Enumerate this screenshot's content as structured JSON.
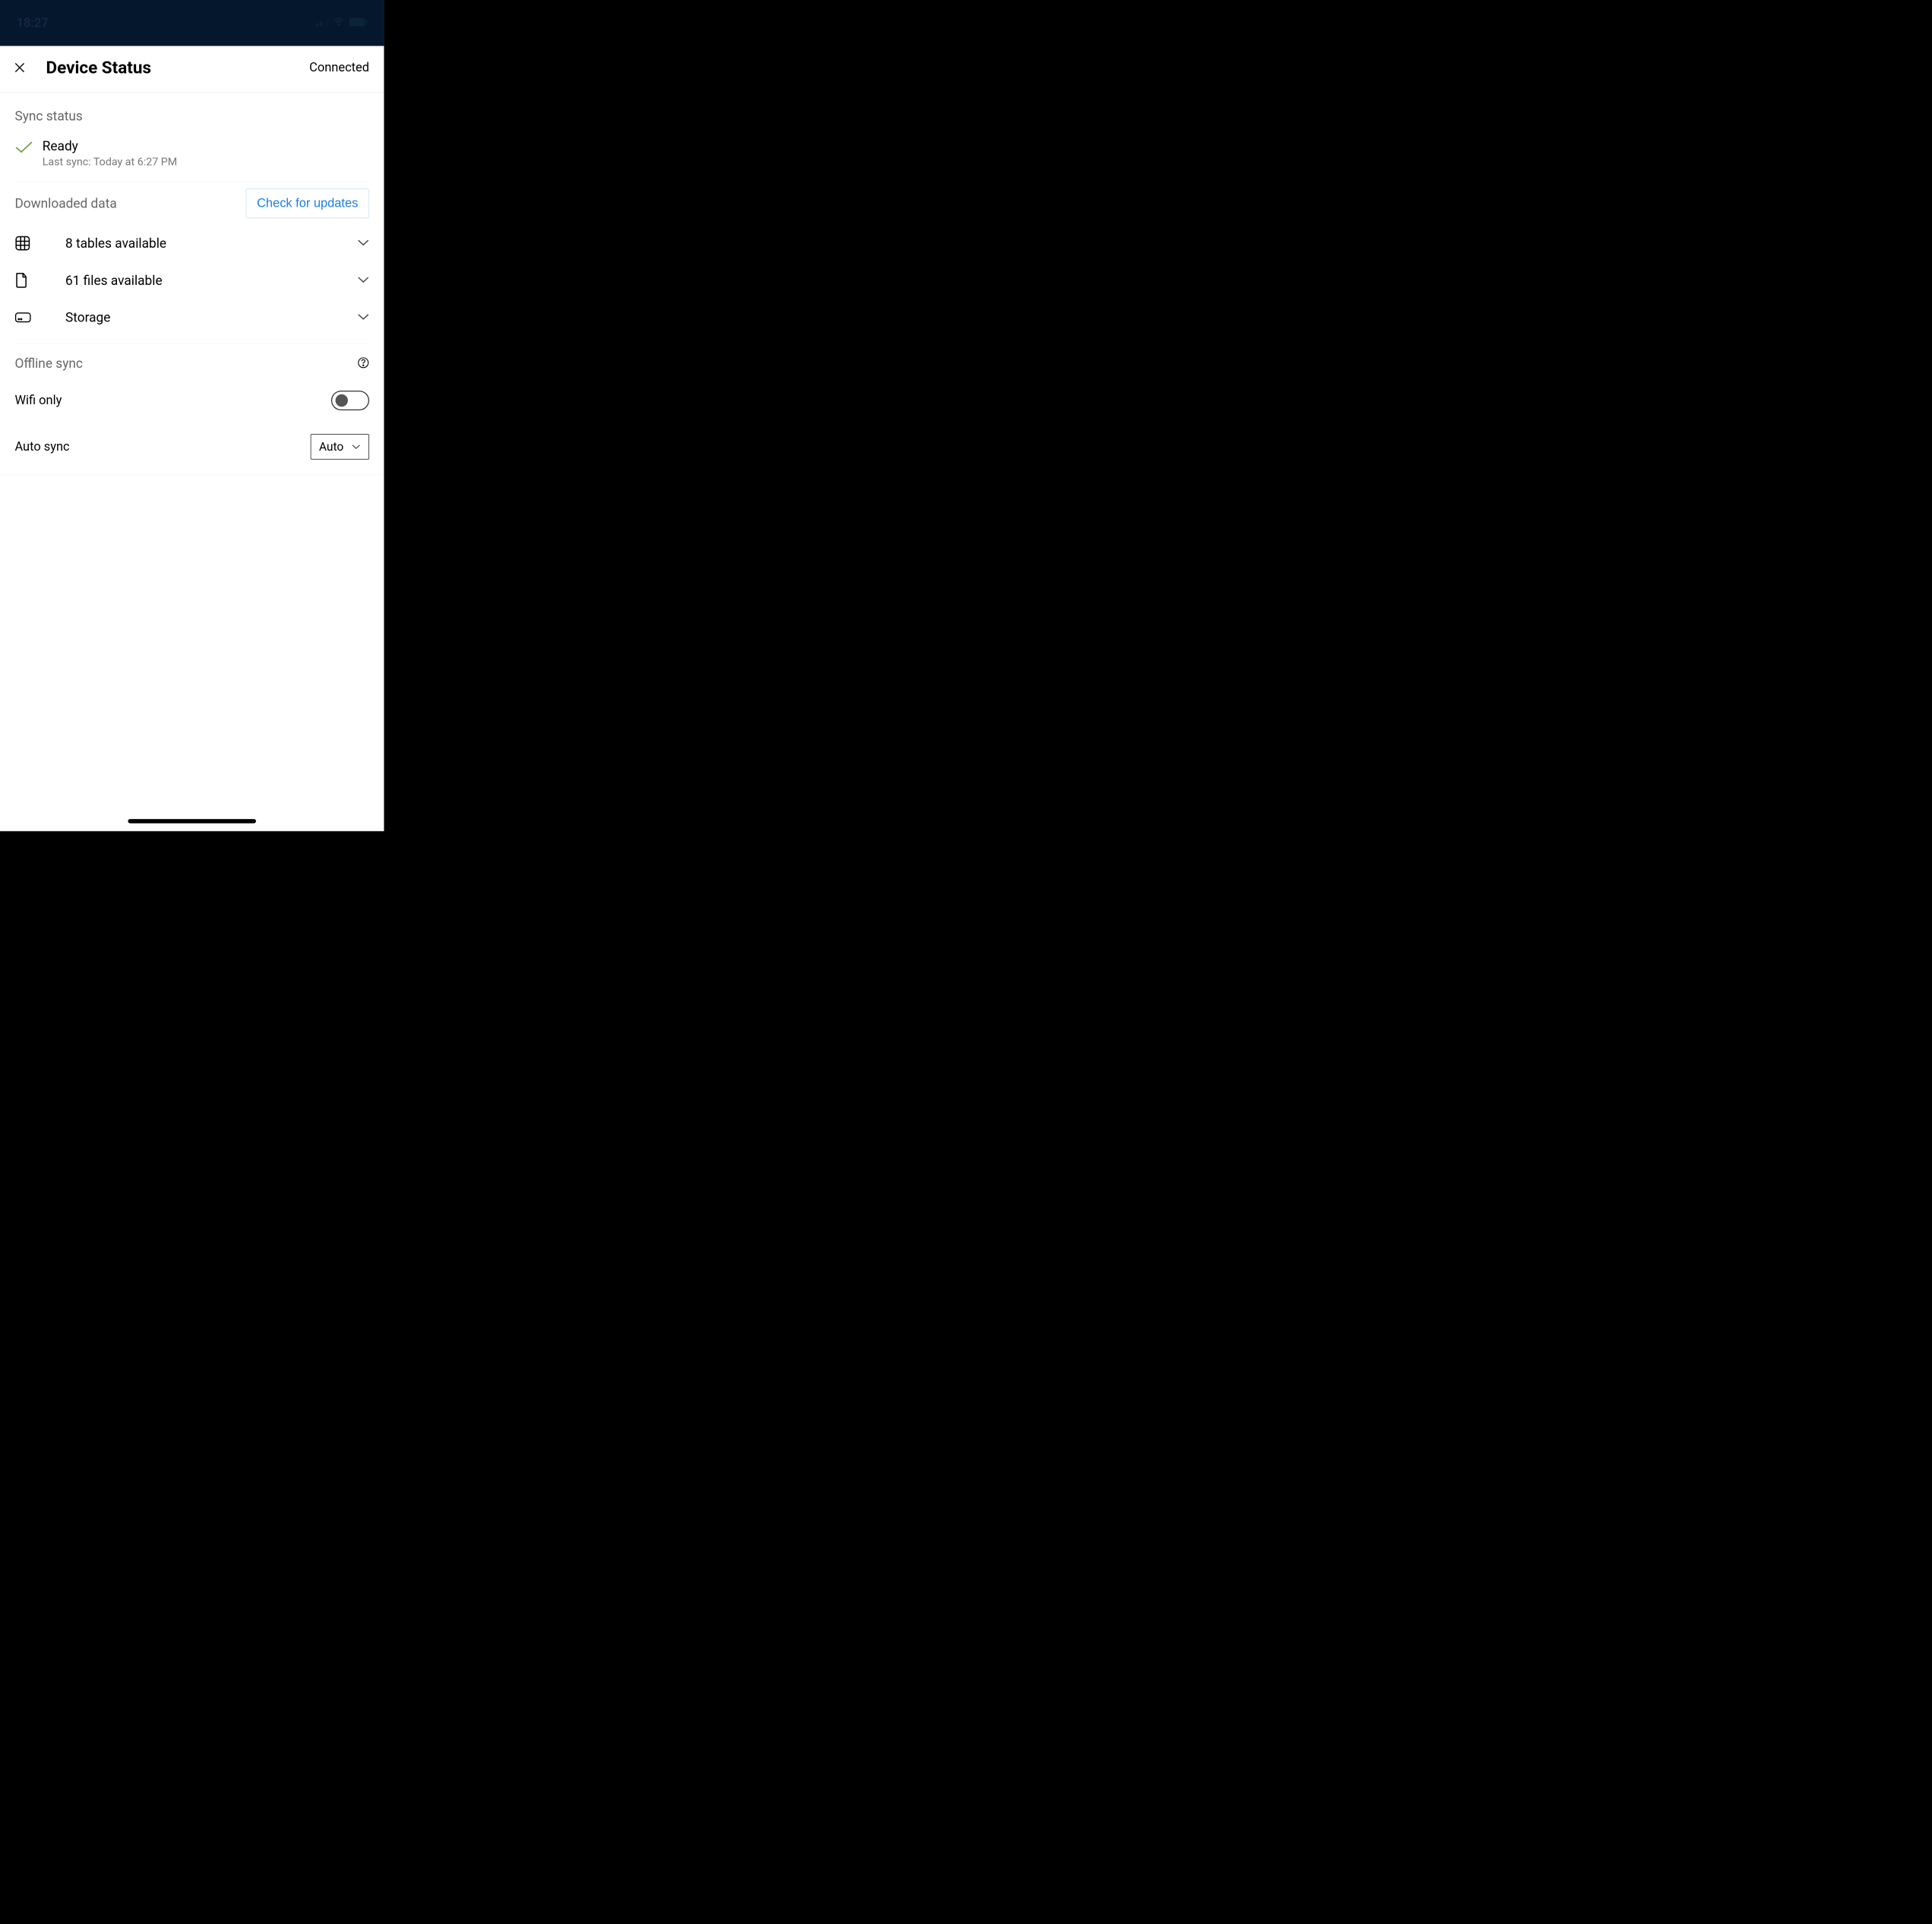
{
  "statusBar": {
    "time": "18:27"
  },
  "header": {
    "title": "Device Status",
    "connectionStatus": "Connected"
  },
  "syncStatus": {
    "sectionTitle": "Sync status",
    "status": "Ready",
    "lastSync": "Last sync: Today at 6:27 PM"
  },
  "downloadedData": {
    "sectionTitle": "Downloaded data",
    "checkUpdatesLabel": "Check for updates",
    "items": [
      {
        "label": "8 tables available",
        "icon": "table"
      },
      {
        "label": "61 files available",
        "icon": "file"
      },
      {
        "label": "Storage",
        "icon": "storage"
      }
    ]
  },
  "offlineSync": {
    "sectionTitle": "Offline sync",
    "wifiOnlyLabel": "Wifi only",
    "wifiOnlyEnabled": false,
    "autoSyncLabel": "Auto sync",
    "autoSyncValue": "Auto"
  }
}
